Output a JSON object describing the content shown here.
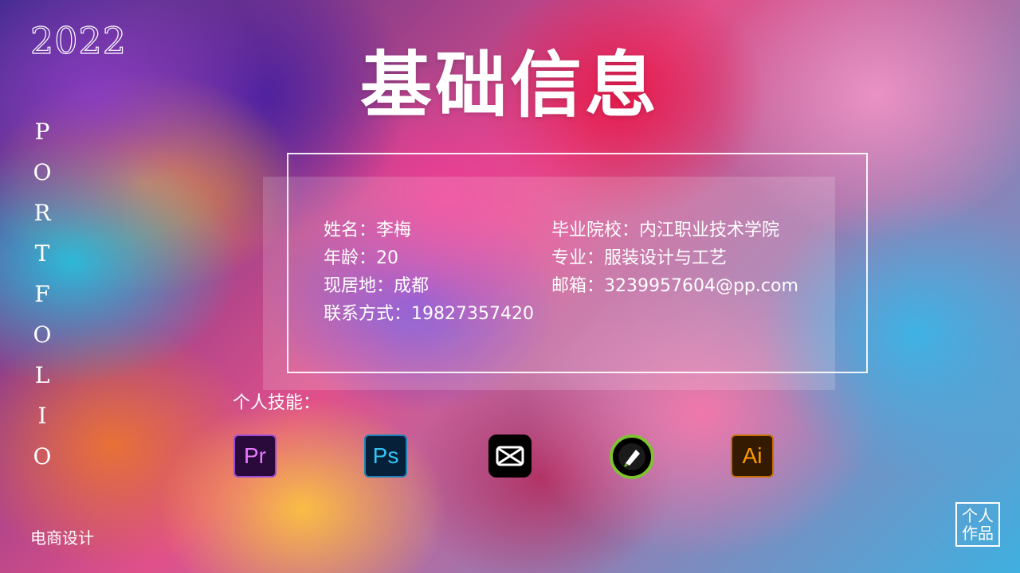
{
  "year": "2022",
  "vertical_text": [
    "P",
    "O",
    "R",
    "T",
    "F",
    "O",
    "L",
    "I",
    "O"
  ],
  "bottom_left": "电商设计",
  "title": "基础信息",
  "info_left": [
    "姓名：李梅",
    "年龄：20",
    "现居地：成都",
    "联系方式：19827357420"
  ],
  "info_right": [
    "毕业院校：内江职业技术学院",
    "专业：服装设计与工艺",
    "邮箱：3239957604@pp.com"
  ],
  "skills_label": "个人技能：",
  "skills": [
    {
      "icon": "premiere-icon",
      "label": "Pr"
    },
    {
      "icon": "photoshop-icon",
      "label": "Ps"
    },
    {
      "icon": "capcut-icon",
      "label": ""
    },
    {
      "icon": "coreldraw-icon",
      "label": ""
    },
    {
      "icon": "illustrator-icon",
      "label": "Ai"
    }
  ],
  "badge": [
    "个人",
    "作品"
  ]
}
